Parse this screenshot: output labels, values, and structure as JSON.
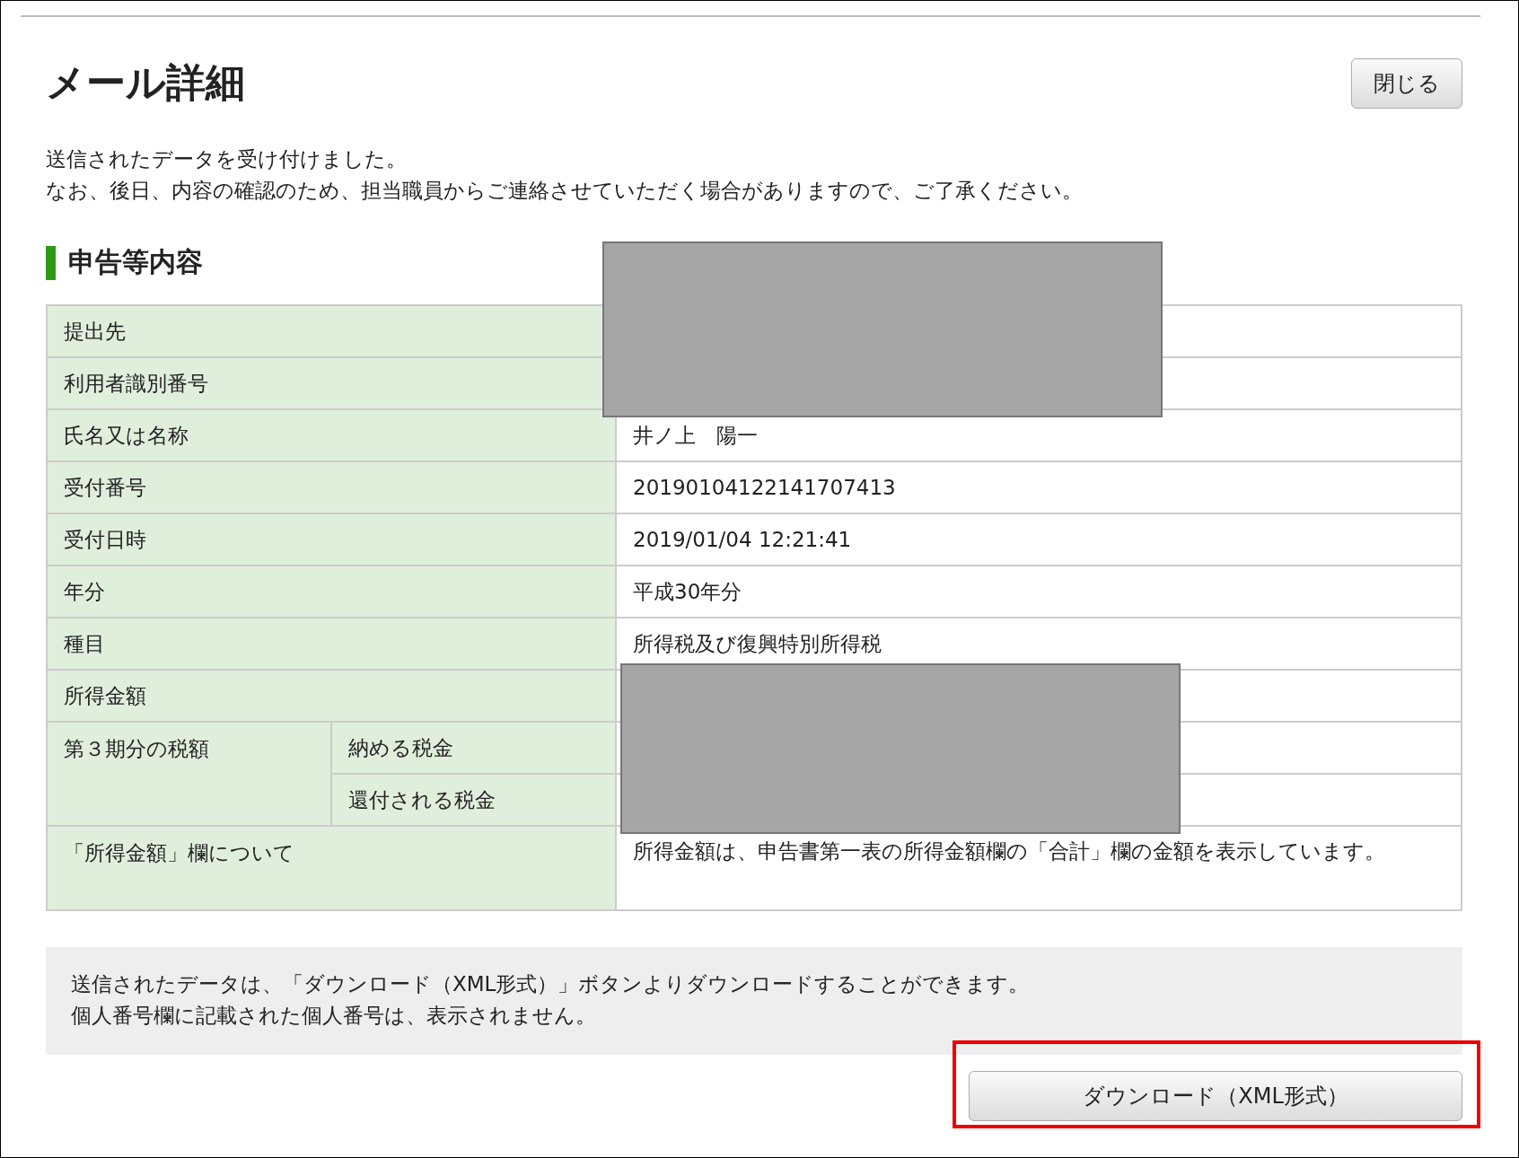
{
  "title": "メール詳細",
  "close_button": "閉じる",
  "message": [
    "送信されたデータを受け付けました。",
    "なお、後日、内容の確認のため、担当職員からご連絡させていただく場合がありますので、ご了承ください。"
  ],
  "section_title": "申告等内容",
  "table": {
    "rows": [
      {
        "kind": "simple",
        "label": "提出先",
        "redacted": true
      },
      {
        "kind": "simple",
        "label": "利用者識別番号",
        "redacted": true
      },
      {
        "kind": "simple",
        "label": "氏名又は名称",
        "value": "井ノ上　陽一",
        "redacted": false
      },
      {
        "kind": "simple",
        "label": "受付番号",
        "value": "20190104122141707413",
        "redacted": false
      },
      {
        "kind": "simple",
        "label": "受付日時",
        "value": "2019/01/04 12:21:41",
        "redacted": false
      },
      {
        "kind": "simple",
        "label": "年分",
        "value": "平成30年分",
        "redacted": false
      },
      {
        "kind": "simple",
        "label": "種目",
        "value": "所得税及び復興特別所得税",
        "redacted": false
      },
      {
        "kind": "simple",
        "label": "所得金額",
        "redacted": true
      },
      {
        "kind": "group",
        "label": "第３期分の税額",
        "subrows": [
          {
            "label": "納める税金",
            "redacted": true
          },
          {
            "label": "還付される税金",
            "redacted": true
          }
        ]
      },
      {
        "kind": "simple",
        "label": "「所得金額」欄について",
        "value": "所得金額は、申告書第一表の所得金額欄の「合計」欄の金額を表示しています。",
        "redacted": false
      }
    ]
  },
  "notice": [
    "送信されたデータは、「ダウンロード（XML形式）」ボタンよりダウンロードすることができます。",
    "個人番号欄に記載された個人番号は、表示されません。"
  ],
  "download_button": {
    "label": "ダウンロード（XML形式）",
    "highlighted": true
  }
}
